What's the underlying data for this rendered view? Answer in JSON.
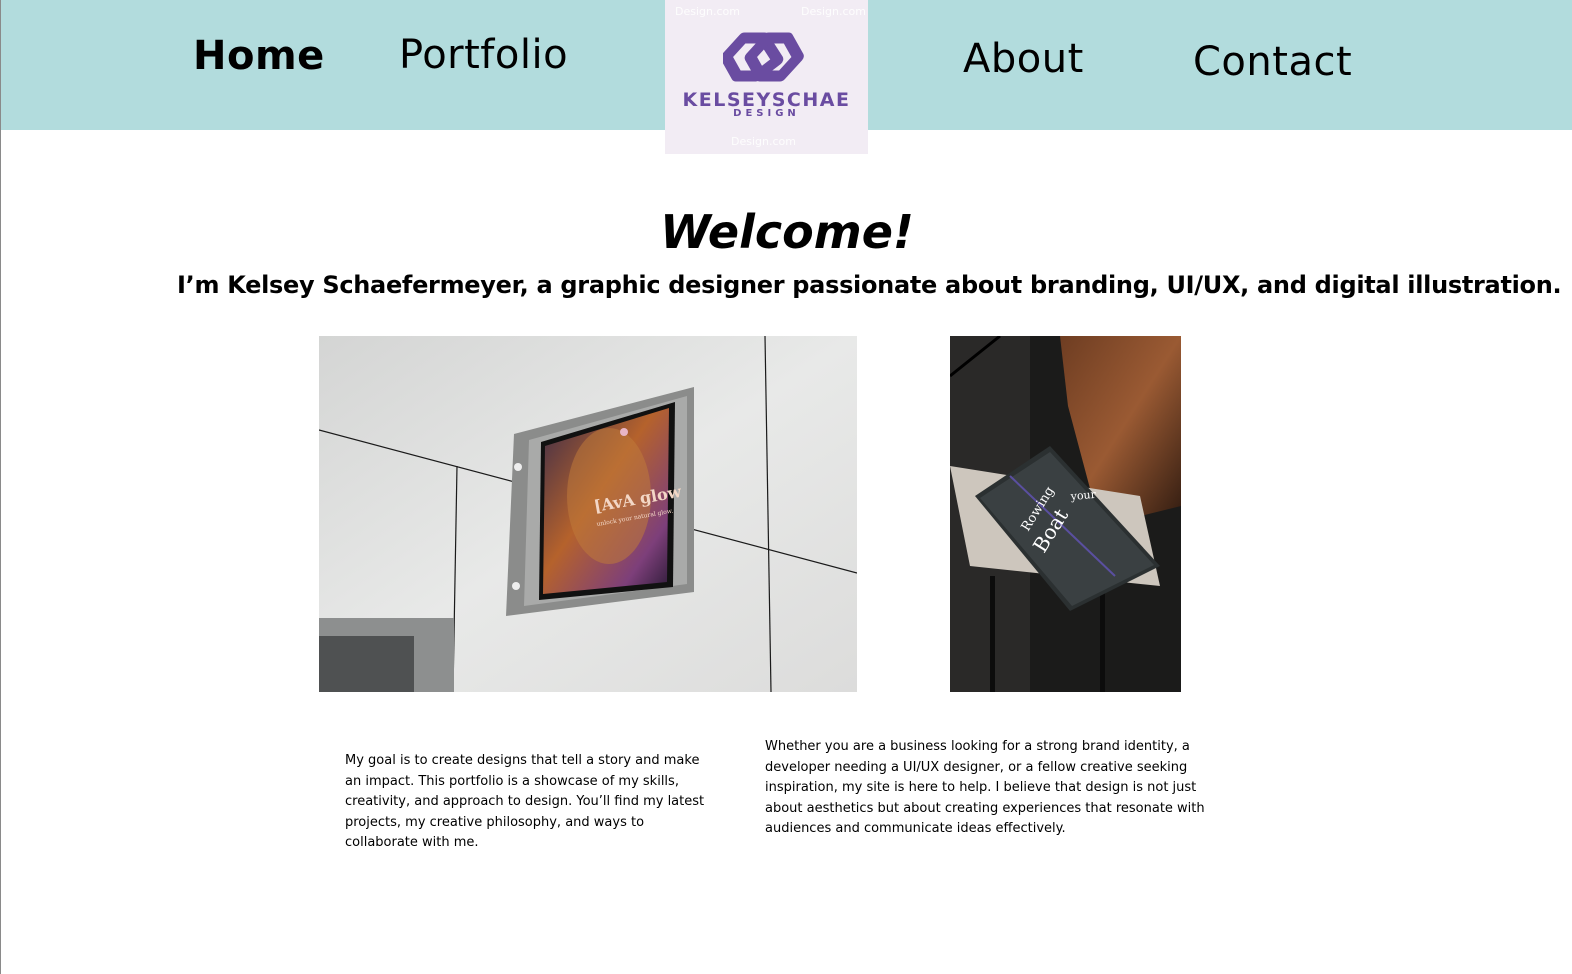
{
  "nav": {
    "home": "Home",
    "portfolio": "Portfolio",
    "about": "About",
    "contact": "Contact"
  },
  "logo": {
    "name": "KELSEYSCHAE",
    "sub": "DESIGN",
    "watermark": "Design.com"
  },
  "hero": {
    "title": "Welcome!",
    "intro": "I’m Kelsey Schaefermeyer, a graphic designer passionate about branding, UI/UX, and digital illustration."
  },
  "images": {
    "poster": {
      "title": "[AvA glow",
      "tagline": "unlock your natural glow."
    },
    "book": {
      "word1": "Rowing",
      "word2": "your",
      "word3": "Boat"
    }
  },
  "paragraphs": {
    "goal": "My goal is to create designs that tell a story and make an impact. This portfolio is a showcase of my skills, creativity, and approach to design. You’ll find my latest projects, my creative philosophy, and ways to collaborate with me.",
    "help": "Whether you are a business looking for a strong brand identity, a developer needing a UI/UX designer, or a fellow creative seeking inspiration, my site is here to help. I believe that design is not just about aesthetics but about creating experiences that resonate with audiences and communicate ideas effectively."
  },
  "colors": {
    "header_bg": "#b2dcdd",
    "logo_bg": "#f2ecf4",
    "brand_purple": "#6a4ca1"
  }
}
